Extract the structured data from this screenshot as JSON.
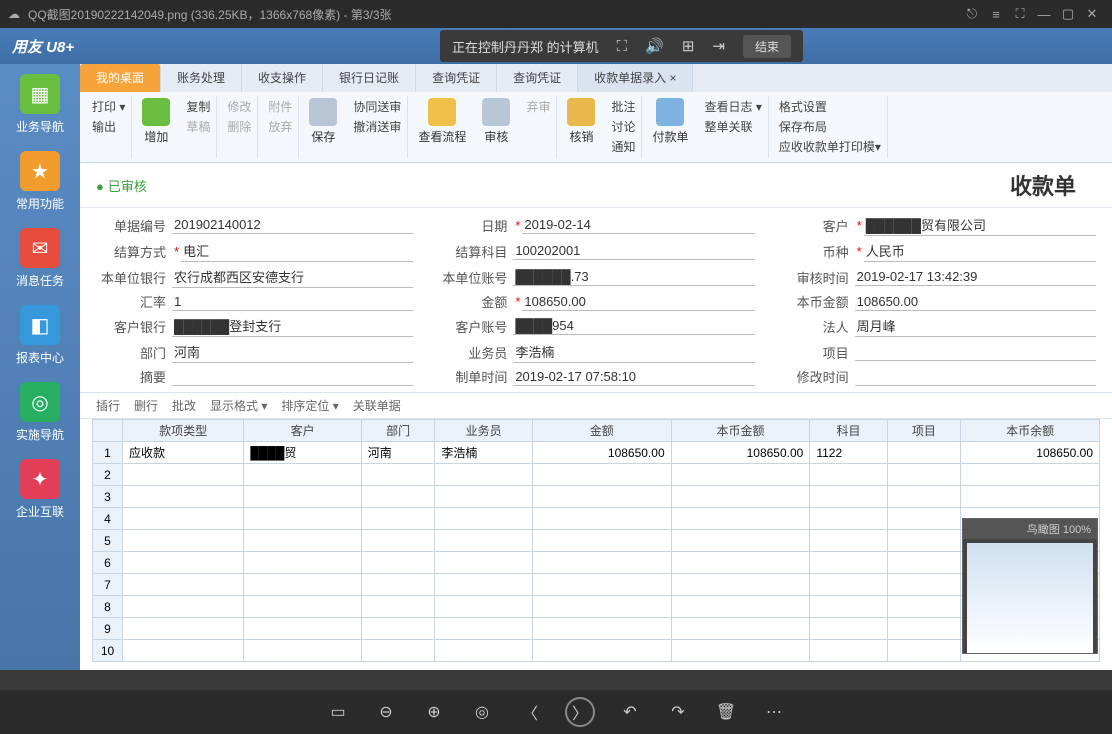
{
  "titlebar": {
    "filename": "QQ截图20190222142049.png (336.25KB，1366x768像素) - 第3/3张"
  },
  "brand": "用友 U8+",
  "remote": {
    "text": "正在控制丹丹郑 的计算机",
    "end": "结束"
  },
  "sidebar": [
    {
      "label": "业务导航",
      "cls": "green",
      "icon": "▦"
    },
    {
      "label": "常用功能",
      "cls": "orange",
      "icon": "★"
    },
    {
      "label": "消息任务",
      "cls": "red",
      "icon": "✉"
    },
    {
      "label": "报表中心",
      "cls": "blue",
      "icon": "◧"
    },
    {
      "label": "实施导航",
      "cls": "teal",
      "icon": "◎"
    },
    {
      "label": "企业互联",
      "cls": "pink",
      "icon": "✦"
    }
  ],
  "tabs": [
    {
      "label": "我的桌面",
      "active": true
    },
    {
      "label": "账务处理"
    },
    {
      "label": "收支操作"
    },
    {
      "label": "银行日记账"
    },
    {
      "label": "查询凭证"
    },
    {
      "label": "查询凭证"
    },
    {
      "label": "收款单据录入",
      "close": true,
      "blue": true
    }
  ],
  "ribbon": {
    "g1": [
      "打印 ▾",
      "输出"
    ],
    "g2big": "增加",
    "g2": [
      "复制",
      "草稿",
      "修改",
      "删除",
      "附件",
      "放弃"
    ],
    "g3big": "保存",
    "g3": [
      "协同送审",
      "撤消送审"
    ],
    "g4big": "查看流程",
    "g5big": "审核",
    "g5": [
      "弃审"
    ],
    "g6big": "核销",
    "g6": [
      "批注",
      "讨论",
      "通知"
    ],
    "g7big": "付款单",
    "g7": [
      "查看日志 ▾",
      "整单关联"
    ],
    "g8": [
      "格式设置",
      "保存布局",
      "应收收款单打印模▾"
    ]
  },
  "status": {
    "approved": "已审核",
    "doctitle": "收款单"
  },
  "form": {
    "docno_label": "单据编号",
    "docno": "201902140012",
    "date_label": "日期",
    "date": "2019-02-14",
    "cust_label": "客户",
    "cust": "██████贸有限公司",
    "settle_label": "结算方式",
    "settle": "电汇",
    "acct_label": "结算科目",
    "acct": "100202001",
    "curr_label": "币种",
    "curr": "人民币",
    "bank_label": "本单位银行",
    "bank": "农行成都西区安德支行",
    "bankacct_label": "本单位账号",
    "bankacct": "██████.73",
    "audit_label": "审核时间",
    "audit": "2019-02-17 13:42:39",
    "rate_label": "汇率",
    "rate": "1",
    "amt_label": "金额",
    "amt": "108650.00",
    "locamt_label": "本币金额",
    "locamt": "108650.00",
    "cbank_label": "客户银行",
    "cbank": "██████登封支行",
    "cacct_label": "客户账号",
    "cacct": "████954",
    "legal_label": "法人",
    "legal": "周月峰",
    "dept_label": "部门",
    "dept": "河南",
    "sales_label": "业务员",
    "sales": "李浩楠",
    "proj_label": "项目",
    "proj": "",
    "memo_label": "摘要",
    "memo": "",
    "maketime_label": "制单时间",
    "maketime": "2019-02-17 07:58:10",
    "modtime_label": "修改时间",
    "modtime": ""
  },
  "gridbar": [
    "插行",
    "删行",
    "批改",
    "显示格式 ▾",
    "排序定位 ▾",
    "关联单据"
  ],
  "grid": {
    "headers": [
      "",
      "款项类型",
      "客户",
      "部门",
      "业务员",
      "金额",
      "本币金额",
      "科目",
      "项目",
      "本币余额"
    ],
    "rows": [
      {
        "n": "1",
        "type": "应收款",
        "cust": "████贸",
        "dept": "河南",
        "sales": "李浩楠",
        "amt": "108650.00",
        "locamt": "108650.00",
        "acct": "1122",
        "proj": "",
        "bal": "108650.00"
      },
      {
        "n": "2"
      },
      {
        "n": "3"
      },
      {
        "n": "4"
      },
      {
        "n": "5"
      },
      {
        "n": "6"
      },
      {
        "n": "7"
      },
      {
        "n": "8"
      },
      {
        "n": "9"
      },
      {
        "n": "10"
      }
    ]
  },
  "thumb": "鸟瞰图 100%"
}
